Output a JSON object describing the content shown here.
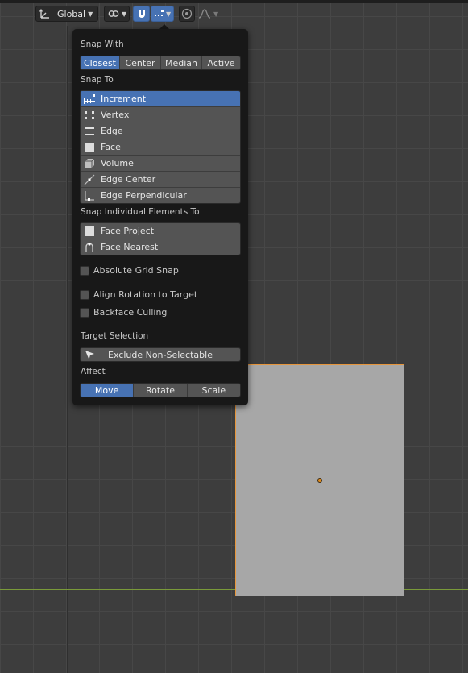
{
  "header": {
    "orientation_value": "Global",
    "icons": [
      "transform-orientation-icon",
      "pivot-link-icon",
      "snap-magnet-icon",
      "snap-increment-icon",
      "proportional-edit-icon",
      "falloff-curve-icon"
    ]
  },
  "popup": {
    "snap_with": {
      "label": "Snap With",
      "options": [
        "Closest",
        "Center",
        "Median",
        "Active"
      ],
      "selected": "Closest"
    },
    "snap_to": {
      "label": "Snap To",
      "items": [
        "Increment",
        "Vertex",
        "Edge",
        "Face",
        "Volume",
        "Edge Center",
        "Edge Perpendicular"
      ],
      "selected": "Increment"
    },
    "snap_individual": {
      "label": "Snap Individual Elements To",
      "items": [
        "Face Project",
        "Face Nearest"
      ]
    },
    "checkboxes": {
      "absolute_grid_snap": "Absolute Grid Snap",
      "align_rotation": "Align Rotation to Target",
      "backface_culling": "Backface Culling"
    },
    "target_selection": {
      "label": "Target Selection",
      "button": "Exclude Non-Selectable"
    },
    "affect": {
      "label": "Affect",
      "options": [
        "Move",
        "Rotate",
        "Scale"
      ],
      "selected": "Move"
    }
  },
  "colors": {
    "accent": "#4772b3",
    "selection_outline": "#e7963c",
    "x_axis": "#7a9a3a"
  }
}
